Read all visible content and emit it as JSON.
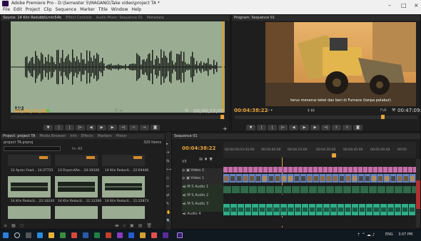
{
  "window": {
    "title": "Adobe Premiere Pro - D:\\Semester 5\\MAGANG\\Take video\\project TA *",
    "menu": [
      "File",
      "Edit",
      "Project",
      "Clip",
      "Sequence",
      "Marker",
      "Title",
      "Window",
      "Help"
    ],
    "minimize": "–",
    "maximize": "□",
    "close": "×"
  },
  "source": {
    "tabs": [
      "Source: 14 Klin RedubbtLmin54b",
      "Effect Controls",
      "Audio Mixer: Sequence 01",
      "Metadata"
    ],
    "timecode_in": "00;00;22;01",
    "timecode_out": "00;00;22;02",
    "zoom_label": "1/2"
  },
  "program": {
    "tab": "Program: Sequence 01",
    "subtitle": "terus menerus tekel dan beri di Furnace (tanpa pelabur)",
    "timecode": "00:04:38:22",
    "fit": "Full",
    "duration": "00:47:09:"
  },
  "project": {
    "tabs": [
      "Project: project TA",
      "Media Browser",
      "Info",
      "Effects",
      "Markers",
      "Histor"
    ],
    "name": "project TA.prproj",
    "items_count": "320 Items",
    "in_label": "In: All",
    "row1": [
      "12 Ayron Fead... 14:27725",
      "13 Dryen.KAe... 24:39326",
      "14 Klin Reducti... 22:04446"
    ],
    "row2": [
      "14 Klin Reducti... 22:10244",
      "14 Klin Reducti... 11:12266",
      "14 Klin Reducti... 11:22873"
    ]
  },
  "sequence": {
    "tab": "Sequence 01",
    "timecode": "00:04:38:22",
    "ruler": [
      "00:00",
      "00:03:45:00",
      "00:04:00:00",
      "00:04:15:00",
      "00:04:30:00",
      "00:04:45:00",
      "00:05:00:00",
      "00:05"
    ],
    "tracks": [
      "V3",
      "Video 2",
      "Video 1",
      "Audio 1",
      "Audio 2",
      "Audio 3",
      "Audio 4"
    ]
  },
  "taskbar": {
    "time": "3:07 PM",
    "lang": "ENG"
  },
  "colors": {
    "accent_timecode": "#e8a33a",
    "waveform_bg": "#9aac92",
    "audio_clip": "#2fae8a",
    "video_clip_title": "#c46fa8",
    "video_clip": "#6a86c0"
  }
}
